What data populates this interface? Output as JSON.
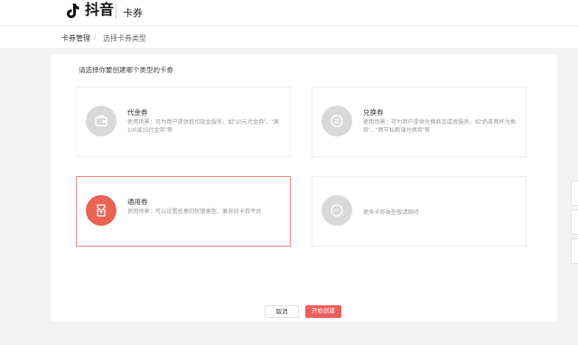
{
  "header": {
    "logo_text": "抖音",
    "section_title": "卡券"
  },
  "breadcrumb": {
    "items": [
      "卡券管理",
      "选择卡券类型"
    ],
    "divider": "/"
  },
  "main": {
    "prompt": "请选择你要创建哪个类型的卡券",
    "cards": [
      {
        "title": "代金券",
        "desc": "使用场景：可为用户提供抵扣现金服务，如“10元代金券”、“满100减15代金券”等",
        "icon": "wallet-icon",
        "selected": false
      },
      {
        "title": "兑换券",
        "desc": "使用场景：可为用户提供兑换商品或者服务，如“奶茶两杯兑换券”、“两节私教课兑换券”等",
        "icon": "exchange-icon",
        "selected": false
      },
      {
        "title": "通用券",
        "desc": "使用场景：可以设置任意的优惠类型，兼容旧卡券平台",
        "icon": "voucher-icon",
        "selected": true
      },
      {
        "title": "",
        "desc": "更多卡券类型敬请期待",
        "icon": "more-icon",
        "selected": false
      }
    ]
  },
  "footer": {
    "cancel_label": "取消",
    "create_label": "开始创建"
  },
  "colors": {
    "accent": "#ef5e5a",
    "selected_border": "#f08a80",
    "icon_gray": "#d9d9d9"
  }
}
